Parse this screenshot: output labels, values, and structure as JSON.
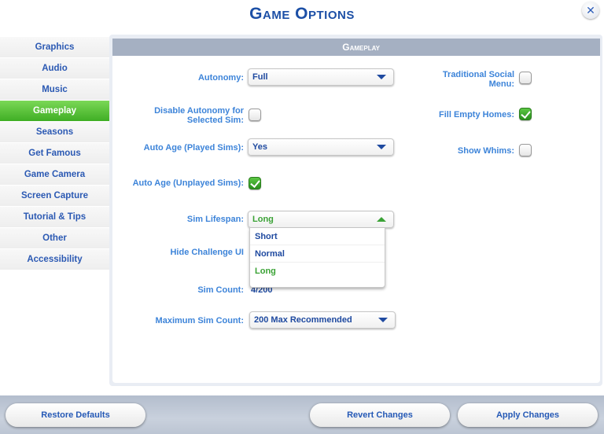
{
  "header": {
    "title": "Game Options",
    "close_icon": "close-icon"
  },
  "sidebar": {
    "items": [
      {
        "label": "Graphics",
        "active": false
      },
      {
        "label": "Audio",
        "active": false
      },
      {
        "label": "Music",
        "active": false
      },
      {
        "label": "Gameplay",
        "active": true
      },
      {
        "label": "Seasons",
        "active": false
      },
      {
        "label": "Get Famous",
        "active": false
      },
      {
        "label": "Game Camera",
        "active": false
      },
      {
        "label": "Screen Capture",
        "active": false
      },
      {
        "label": "Tutorial & Tips",
        "active": false
      },
      {
        "label": "Other",
        "active": false
      },
      {
        "label": "Accessibility",
        "active": false
      }
    ]
  },
  "panel": {
    "title": "Gameplay",
    "autonomy": {
      "label": "Autonomy:",
      "value": "Full"
    },
    "disable_autonomy": {
      "label_line1": "Disable Autonomy for",
      "label_line2": "Selected Sim:",
      "checked": false
    },
    "auto_age_played": {
      "label": "Auto Age (Played Sims):",
      "value": "Yes"
    },
    "auto_age_unplayed": {
      "label": "Auto Age (Unplayed Sims):",
      "checked": true
    },
    "sim_lifespan": {
      "label": "Sim Lifespan:",
      "value": "Long",
      "options": [
        "Short",
        "Normal",
        "Long"
      ]
    },
    "hide_challenge_ui": {
      "label": "Hide Challenge UI"
    },
    "sim_count": {
      "label": "Sim Count:",
      "value": "4/200"
    },
    "max_sim_count": {
      "label": "Maximum Sim Count:",
      "value": "200 Max Recommended"
    },
    "traditional_social_menu": {
      "label_line1": "Traditional Social",
      "label_line2": "Menu:",
      "checked": false
    },
    "fill_empty_homes": {
      "label": "Fill Empty Homes:",
      "checked": true
    },
    "show_whims": {
      "label": "Show Whims:",
      "checked": false
    }
  },
  "footer": {
    "restore_defaults": "Restore Defaults",
    "revert_changes": "Revert Changes",
    "apply_changes": "Apply Changes"
  },
  "colors": {
    "title_blue": "#1c4fa6",
    "label_blue": "#3d84d9",
    "active_green": "#3fae24",
    "selected_option_green": "#3aa235"
  }
}
